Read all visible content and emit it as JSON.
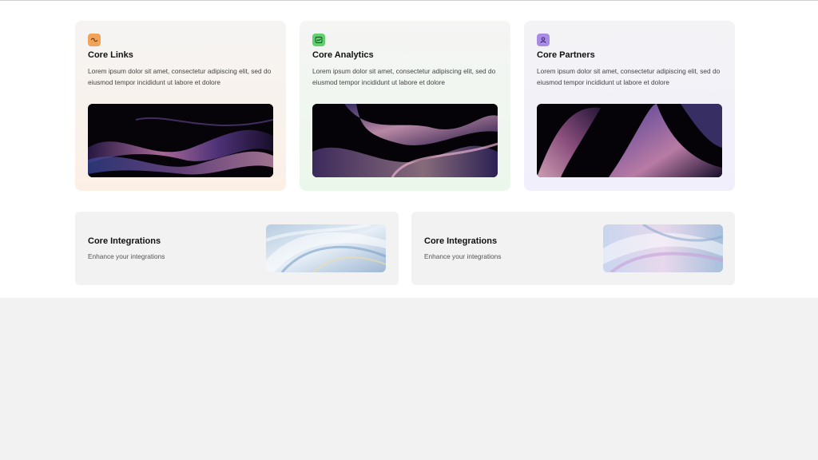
{
  "features": [
    {
      "title": "Core Links",
      "description": "Lorem ipsum dolor sit amet, consectetur adipiscing elit, sed do eiusmod tempor incididunt ut labore et dolore",
      "icon": "link-icon",
      "icon_color": "#f0a35a"
    },
    {
      "title": "Core Analytics",
      "description": "Lorem ipsum dolor sit amet, consectetur adipiscing elit, sed do eiusmod tempor incididunt ut labore et dolore",
      "icon": "chart-icon",
      "icon_color": "#5fcf6f"
    },
    {
      "title": "Core Partners",
      "description": "Lorem ipsum dolor sit amet, consectetur adipiscing elit, sed do eiusmod tempor incididunt ut labore et dolore",
      "icon": "user-icon",
      "icon_color": "#a98be6"
    }
  ],
  "integrations": [
    {
      "title": "Core Integrations",
      "subtitle": "Enhance your integrations"
    },
    {
      "title": "Core Integrations",
      "subtitle": "Enhance your integrations"
    }
  ]
}
